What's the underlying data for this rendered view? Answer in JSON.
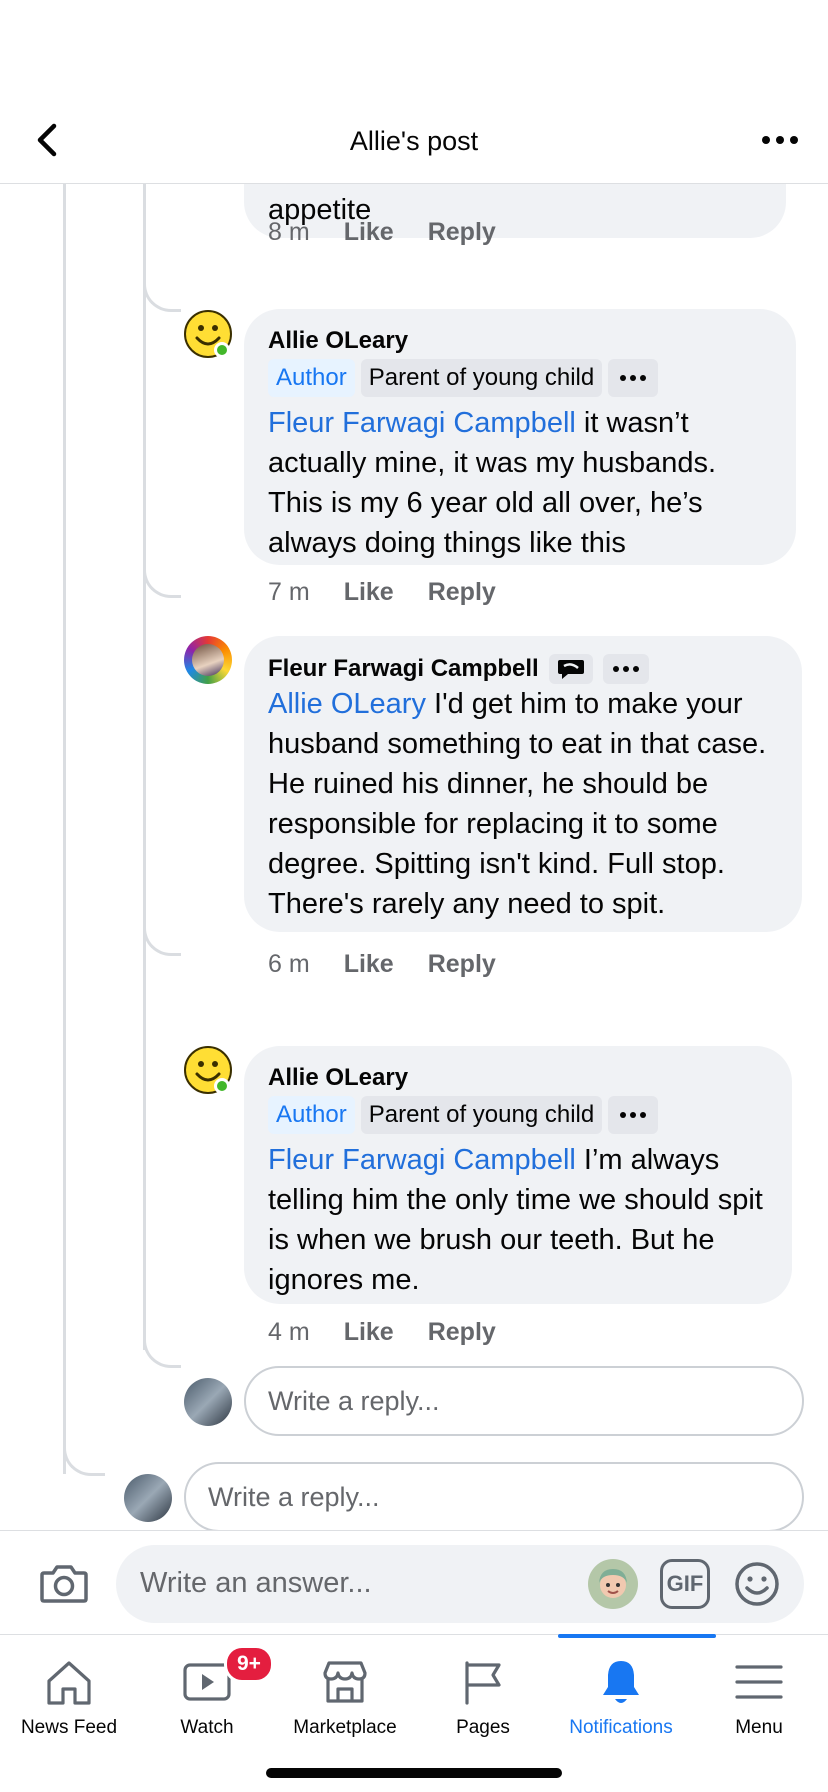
{
  "header": {
    "title": "Allie's post"
  },
  "thread": {
    "partial_comment": {
      "text_tail": "appetite",
      "time": "8 m",
      "like": "Like",
      "reply": "Reply"
    },
    "comments": [
      {
        "author": "Allie OLeary",
        "badge_author": "Author",
        "badge_role": "Parent of young child",
        "mention": "Fleur Farwagi Campbell",
        "text": " it wasn’t actually mine, it was my husbands. This is my 6 year old all over, he’s always doing things like this",
        "time": "7 m",
        "like": "Like",
        "reply": "Reply"
      },
      {
        "author": "Fleur Farwagi Campbell",
        "mention": "Allie OLeary",
        "text": " I'd get him to make your husband something to eat in that case. He ruined his dinner, he should be responsible for replacing it to some degree. Spitting isn't kind. Full stop. There's rarely any need to spit.",
        "time": "6 m",
        "like": "Like",
        "reply": "Reply"
      },
      {
        "author": "Allie OLeary",
        "badge_author": "Author",
        "badge_role": "Parent of young child",
        "mention": "Fleur Farwagi Campbell",
        "text": " I’m always telling him the only time we should spit is when we brush our teeth. But he ignores me.",
        "time": "4 m",
        "like": "Like",
        "reply": "Reply"
      }
    ],
    "nested_reply_placeholder": "Write a reply...",
    "reply_placeholder": "Write a reply..."
  },
  "composer": {
    "placeholder": "Write an answer...",
    "gif_label": "GIF"
  },
  "nav": {
    "tabs": [
      {
        "label": "News Feed",
        "icon": "home-icon"
      },
      {
        "label": "Watch",
        "icon": "watch-icon",
        "badge": "9+"
      },
      {
        "label": "Marketplace",
        "icon": "marketplace-icon"
      },
      {
        "label": "Pages",
        "icon": "flag-icon"
      },
      {
        "label": "Notifications",
        "icon": "bell-icon",
        "active": true
      },
      {
        "label": "Menu",
        "icon": "hamburger-icon"
      }
    ]
  },
  "colors": {
    "accent": "#1877f2",
    "mention": "#216fdb",
    "bubble": "#f0f2f5",
    "secondary_text": "#65676b",
    "badge_red": "#e41e3f",
    "online": "#42b72a"
  }
}
